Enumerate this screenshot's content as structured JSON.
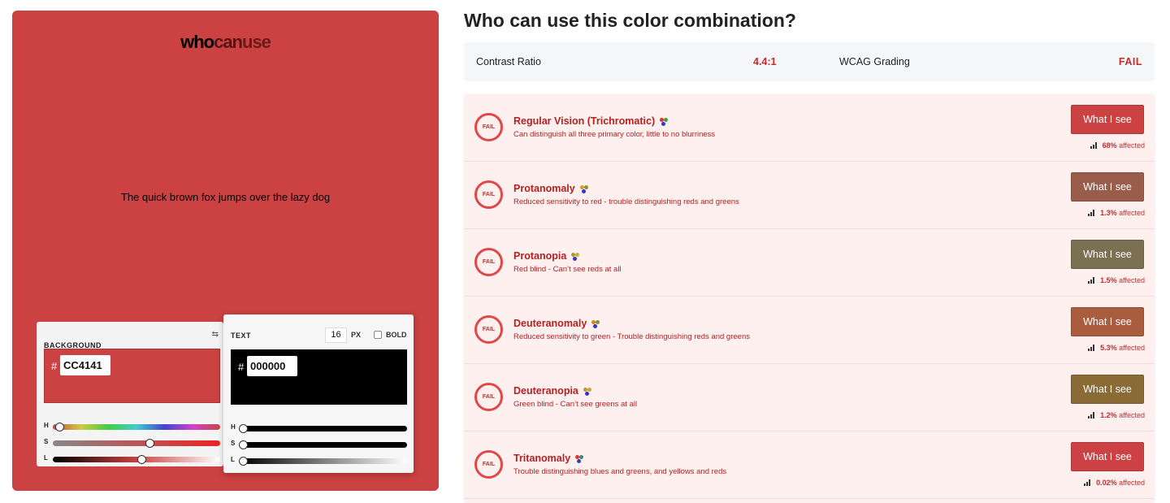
{
  "logo": {
    "who": "who",
    "can": "can",
    "use": "use"
  },
  "preview": {
    "sample_text": "The quick brown fox jumps over the lazy dog",
    "background_color": "#cc4141",
    "text_color": "#000000"
  },
  "background_panel": {
    "label": "BACKGROUND",
    "hash": "#",
    "hex_value": "CC4141",
    "sliders": [
      {
        "label": "H",
        "value": 0.02
      },
      {
        "label": "S",
        "value": 0.58
      },
      {
        "label": "L",
        "value": 0.53
      }
    ]
  },
  "text_panel": {
    "label": "TEXT",
    "font_size": "16",
    "unit_label": "PX",
    "bold_label": "BOLD",
    "hash": "#",
    "hex_value": "000000",
    "sliders": [
      {
        "label": "H",
        "value": 0
      },
      {
        "label": "S",
        "value": 0
      },
      {
        "label": "L",
        "value": 0
      }
    ]
  },
  "page_title": "Who can use this color combination?",
  "summary": {
    "contrast_label": "Contrast Ratio",
    "contrast_value": "4.4:1",
    "grading_label": "WCAG Grading",
    "grading_value": "FAIL"
  },
  "visions": [
    {
      "badge": "FAIL",
      "title": "Regular Vision (Trichromatic)",
      "description": "Can distinguish all three primary color, little to no blurriness",
      "button_label": "What I see",
      "button_color": "#cc4141",
      "percent": "68%",
      "affected_label": "affected"
    },
    {
      "badge": "FAIL",
      "title": "Protanomaly",
      "description": "Reduced sensitivity to red - trouble distinguishing reds and greens",
      "button_label": "What I see",
      "button_color": "#9a5d4b",
      "percent": "1.3%",
      "affected_label": "affected"
    },
    {
      "badge": "FAIL",
      "title": "Protanopia",
      "description": "Red blind - Can’t see reds at all",
      "button_label": "What I see",
      "button_color": "#7b7152",
      "percent": "1.5%",
      "affected_label": "affected"
    },
    {
      "badge": "FAIL",
      "title": "Deuteranomaly",
      "description": "Reduced sensitivity to green - Trouble distinguishing reds and greens",
      "button_label": "What I see",
      "button_color": "#a95c3e",
      "percent": "5.3%",
      "affected_label": "affected"
    },
    {
      "badge": "FAIL",
      "title": "Deuteranopia",
      "description": "Green blind - Can’t see greens at all",
      "button_label": "What I see",
      "button_color": "#8a6a35",
      "percent": "1.2%",
      "affected_label": "affected"
    },
    {
      "badge": "FAIL",
      "title": "Tritanomaly",
      "description": "Trouble distinguishing blues and greens, and yellows and reds",
      "button_label": "What I see",
      "button_color": "#cc4143",
      "percent": "0.02%",
      "affected_label": "affected"
    }
  ],
  "colors": {
    "accent": "#c92a2a",
    "list_background": "#fff0f0"
  }
}
